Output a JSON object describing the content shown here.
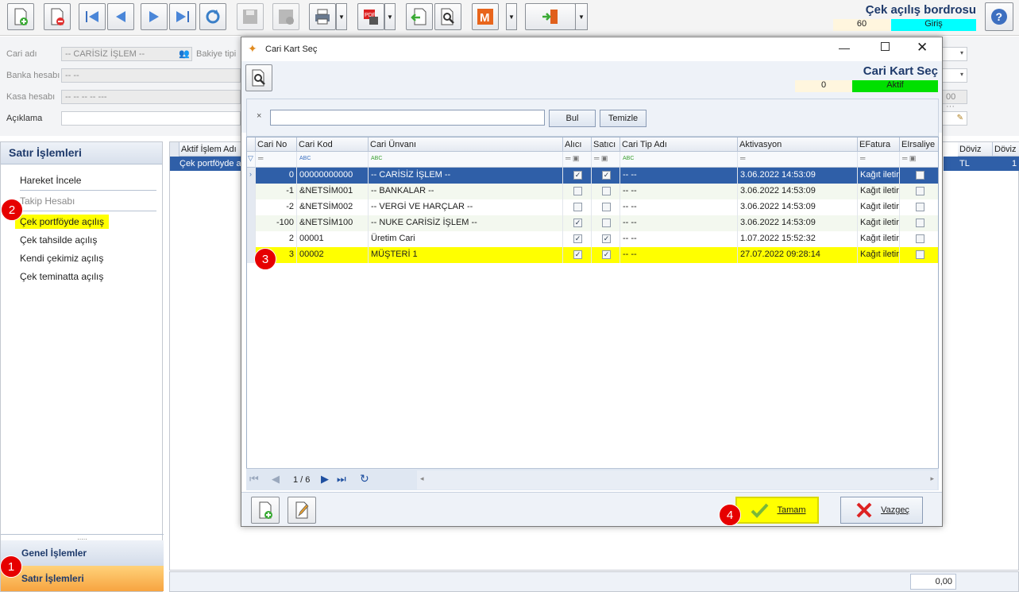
{
  "window": {
    "title": "Çek açılış bordrosu",
    "record_no": "60",
    "mode": "Giriş"
  },
  "toolbar": {
    "icons": [
      "new-document-icon",
      "delete-document-icon",
      "first-record-icon",
      "previous-record-icon",
      "next-record-icon",
      "last-record-icon",
      "refresh-icon",
      "save-icon",
      "save-close-icon",
      "print-icon",
      "export-pdf-icon",
      "import-icon",
      "search-tool-icon",
      "m-module-icon",
      "exit-door-icon",
      "help-icon"
    ]
  },
  "form": {
    "cari_label": "Cari adı",
    "cari_value": "-- CARİSİZ İŞLEM --",
    "bakiye_label": "Bakiye tipi",
    "banka_label": "Banka hesabı",
    "banka_value": "-- --",
    "kasa_label": "Kasa hesabı",
    "kasa_value": "-- -- -- -- ---",
    "aciklama_label": "Açıklama",
    "right_value": "00 ···"
  },
  "left_panel": {
    "title": "Satır İşlemleri",
    "items": [
      "Hareket İncele",
      "Takip Hesabı",
      "Çek portföyde açılış",
      "Çek tahsilde açılış",
      "Kendi çekimiz açılış",
      "Çek teminatta açılış"
    ],
    "nav": [
      "Genel İşlemler",
      "Satır İşlemleri"
    ],
    "splitter": "....."
  },
  "main_grid": {
    "col_aktif": "Aktif İşlem Adı",
    "row_aktif": "Çek portföyde a",
    "col_doviz1": "Döviz",
    "col_doviz2": "Döviz",
    "doviz_value": "TL",
    "doviz_value2": "1",
    "total": "0,00"
  },
  "dialog": {
    "title": "Cari Kart Seç",
    "heading": "Cari Kart Seç",
    "count": "0",
    "status": "Aktif",
    "search_value": "",
    "find_label": "Bul",
    "clear_label": "Temizle",
    "clear_search_glyph": "×",
    "columns": [
      "Cari No",
      "Cari Kod",
      "Cari Ünvanı",
      "Alıcı",
      "Satıcı",
      "Cari Tip Adı",
      "Aktivasyon",
      "EFatura",
      "EIrsaliye"
    ],
    "rows": [
      {
        "no": "0",
        "kod": "00000000000",
        "unvan": "-- CARİSİZ İŞLEM --",
        "alici": true,
        "satici": true,
        "tip": "-- --",
        "aktivasyon": "3.06.2022 14:53:09",
        "efatura": "Kağıt iletin",
        "eirsaliye": false
      },
      {
        "no": "-1",
        "kod": "&NETSİM001",
        "unvan": "-- BANKALAR --",
        "alici": false,
        "satici": false,
        "tip": "-- --",
        "aktivasyon": "3.06.2022 14:53:09",
        "efatura": "Kağıt iletin",
        "eirsaliye": false
      },
      {
        "no": "-2",
        "kod": "&NETSİM002",
        "unvan": "-- VERGİ VE HARÇLAR --",
        "alici": false,
        "satici": false,
        "tip": "-- --",
        "aktivasyon": "3.06.2022 14:53:09",
        "efatura": "Kağıt iletin",
        "eirsaliye": false
      },
      {
        "no": "-100",
        "kod": "&NETSİM100",
        "unvan": "-- NUKE CARİSİZ İŞLEM --",
        "alici": true,
        "satici": false,
        "tip": "-- --",
        "aktivasyon": "3.06.2022 14:53:09",
        "efatura": "Kağıt iletin",
        "eirsaliye": false
      },
      {
        "no": "2",
        "kod": "00001",
        "unvan": "Üretim Cari",
        "alici": true,
        "satici": true,
        "tip": "-- --",
        "aktivasyon": "1.07.2022 15:52:32",
        "efatura": "Kağıt iletin",
        "eirsaliye": false
      },
      {
        "no": "3",
        "kod": "00002",
        "unvan": "MÜŞTERİ 1",
        "alici": true,
        "satici": true,
        "tip": "-- --",
        "aktivasyon": "27.07.2022 09:28:14",
        "efatura": "Kağıt iletin",
        "eirsaliye": false
      }
    ],
    "pager": "1 / 6",
    "ok_label": "Tamam",
    "cancel_label": "Vazgeç"
  },
  "annotations": [
    "1",
    "2",
    "3",
    "4"
  ],
  "colors": {
    "highlight_yellow": "#ffff00",
    "selected_row": "#2f5fa8",
    "active_green": "#00e000",
    "giris_cyan": "#00ffff",
    "badge_red": "#e60000",
    "nav_orange": "#f7a440"
  }
}
